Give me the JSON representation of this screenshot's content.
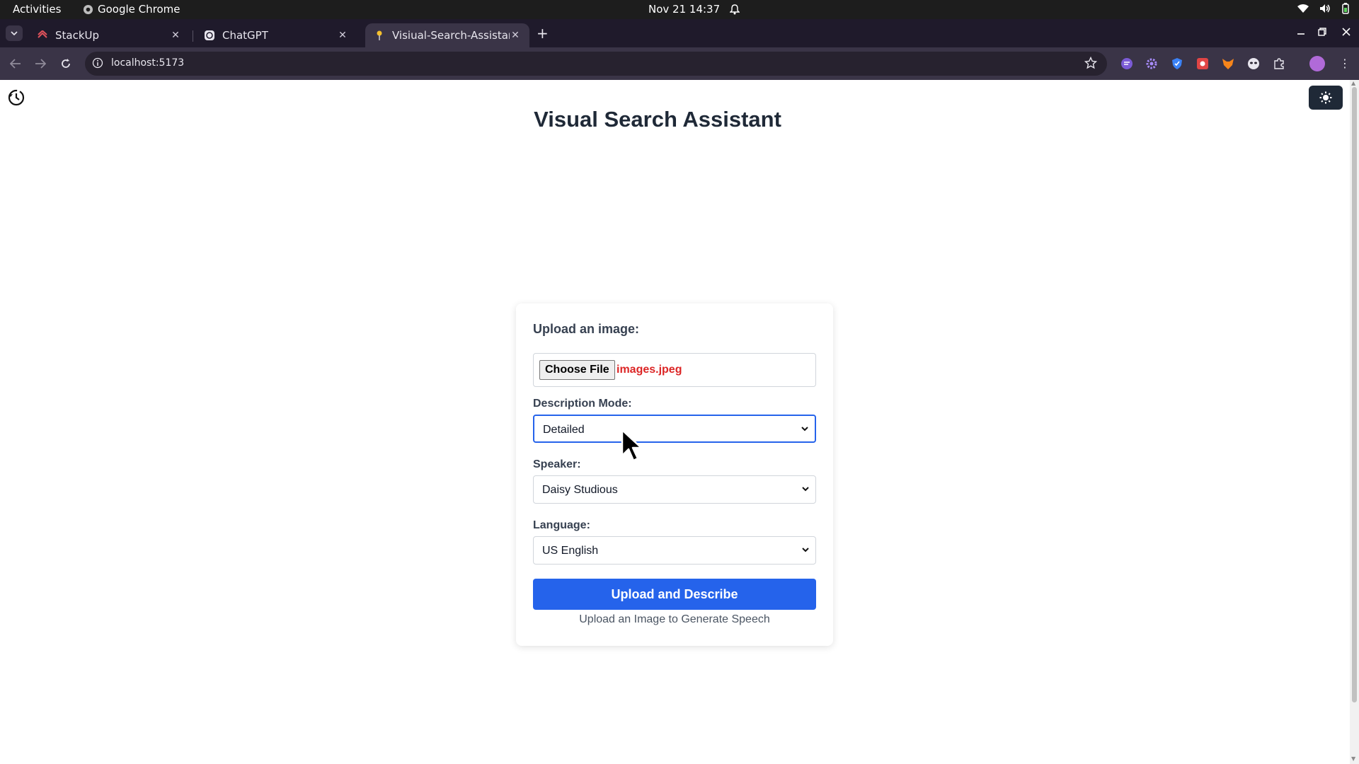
{
  "os_bar": {
    "activities": "Activities",
    "app_name": "Google Chrome",
    "datetime": "Nov 21  14:37",
    "icons": [
      "chrome-icon",
      "bell-icon",
      "wifi-icon",
      "volume-icon",
      "battery-icon"
    ]
  },
  "browser": {
    "tabs": [
      {
        "title": "StackUp",
        "icon": "stackup-icon"
      },
      {
        "title": "ChatGPT",
        "icon": "chatgpt-icon"
      },
      {
        "title": "Visiual-Search-Assistant",
        "icon": "pin-icon",
        "active": true
      }
    ],
    "url": "localhost:5173",
    "extensions": [
      "ext-chat-icon",
      "ext-gear-icon",
      "ext-shield-icon",
      "ext-red-icon",
      "ext-fox-icon",
      "ext-mask-icon",
      "puzzle-icon"
    ],
    "colors": {
      "frame": "#1f1a2b",
      "toolbar": "#3a3447",
      "omnibox": "#27222f"
    }
  },
  "app": {
    "title": "Visual Search Assistant",
    "upload": {
      "label": "Upload an image:",
      "button": "Choose File",
      "filename": "images.jpeg"
    },
    "mode": {
      "label": "Description Mode:",
      "value": "Detailed"
    },
    "speaker": {
      "label": "Speaker:",
      "value": "Daisy Studious"
    },
    "language": {
      "label": "Language:",
      "value": "US English"
    },
    "submit": "Upload and Describe",
    "hint": "Upload an Image to Generate Speech",
    "colors": {
      "primary": "#2563eb",
      "filename": "#dc2626",
      "title": "#1f2937"
    }
  }
}
